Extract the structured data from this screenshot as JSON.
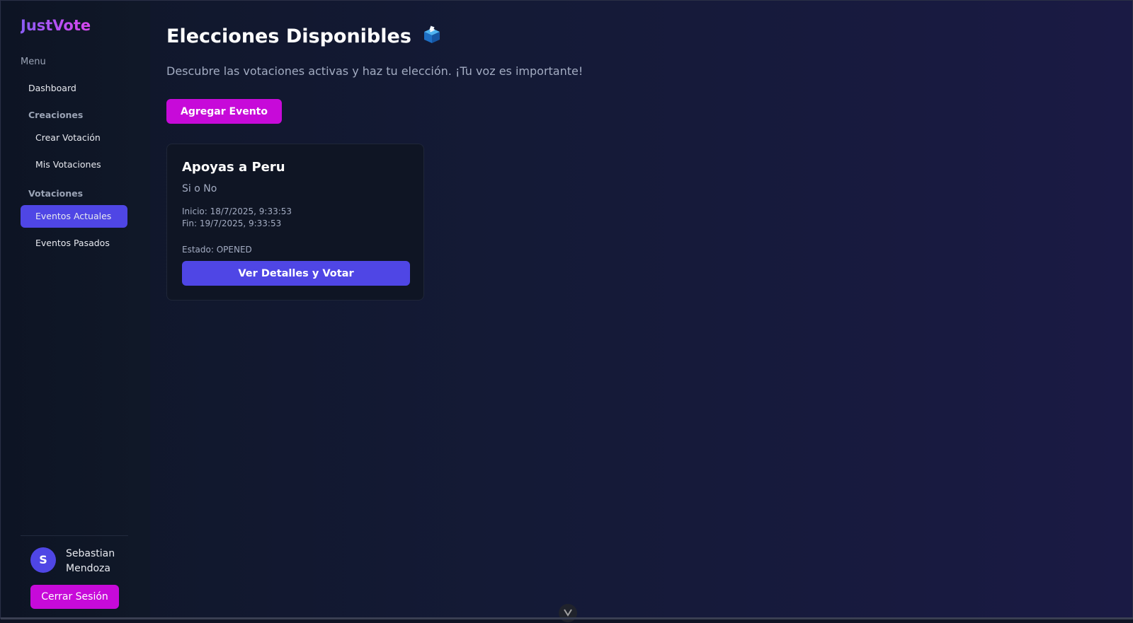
{
  "app": {
    "logo": "JustVote"
  },
  "sidebar": {
    "menu_label": "Menu",
    "dashboard": "Dashboard",
    "section_creations": "Creaciones",
    "create_vote": "Crear Votación",
    "my_votes": "Mis Votaciones",
    "section_votes": "Votaciones",
    "current_events": "Eventos Actuales",
    "past_events": "Eventos Pasados",
    "active_item": "Eventos Actuales"
  },
  "user": {
    "initial": "S",
    "name": "Sebastian Mendoza",
    "logout_label": "Cerrar Sesión"
  },
  "main": {
    "title": "Elecciones Disponibles",
    "title_icon": "ballot-box-icon",
    "subtitle": "Descubre las votaciones activas y haz tu elección. ¡Tu voz es importante!",
    "add_event_label": "Agregar Evento"
  },
  "events": [
    {
      "title": "Apoyas a Peru",
      "description": "Si o No",
      "start": "Inicio: 18/7/2025, 9:33:53",
      "end": "Fin: 19/7/2025, 9:33:53",
      "status": "Estado: OPENED",
      "action_label": "Ver Detalles y Votar"
    }
  ],
  "scroll_hint_icon": "chevron-down-icon",
  "colors": {
    "accent_primary": "#4f46e5",
    "accent_magenta": "#c70ad9"
  }
}
